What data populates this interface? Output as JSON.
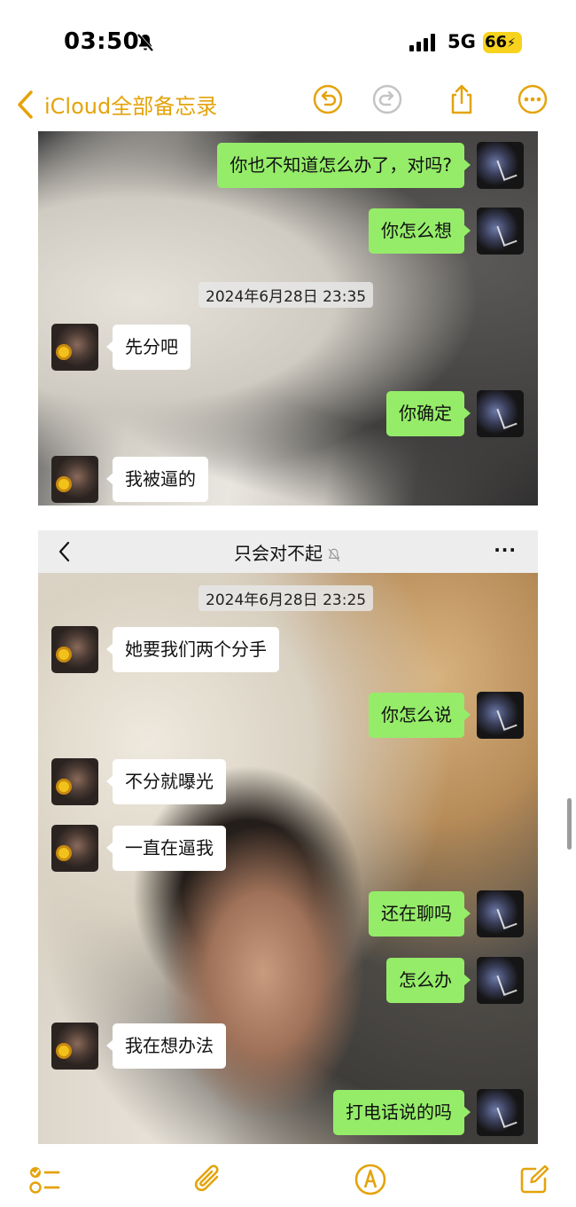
{
  "status_bar": {
    "time": "03:50",
    "network": "5G",
    "battery": "66"
  },
  "notes_nav": {
    "back_label": "iCloud全部备忘录"
  },
  "pane1": {
    "timestamp": "2024年6月28日 23:35",
    "messages": [
      {
        "side": "right",
        "text": "你也不知道怎么办了，对吗?"
      },
      {
        "side": "right",
        "text": "你怎么想"
      },
      {
        "side": "left",
        "text": "先分吧"
      },
      {
        "side": "right",
        "text": "你确定"
      },
      {
        "side": "left",
        "text": "我被逼的"
      }
    ]
  },
  "pane2": {
    "chat_title": "只会对不起",
    "more": "···",
    "timestamp": "2024年6月28日 23:25",
    "messages": [
      {
        "side": "left",
        "text": "她要我们两个分手"
      },
      {
        "side": "right",
        "text": "你怎么说"
      },
      {
        "side": "left",
        "text": "不分就曝光"
      },
      {
        "side": "left",
        "text": "一直在逼我"
      },
      {
        "side": "right",
        "text": "还在聊吗"
      },
      {
        "side": "right",
        "text": "怎么办"
      },
      {
        "side": "left",
        "text": "我在想办法"
      },
      {
        "side": "right",
        "text": "打电话说的吗"
      }
    ]
  },
  "colors": {
    "accent": "#e4a30b",
    "wechat_green": "#95ec69"
  }
}
